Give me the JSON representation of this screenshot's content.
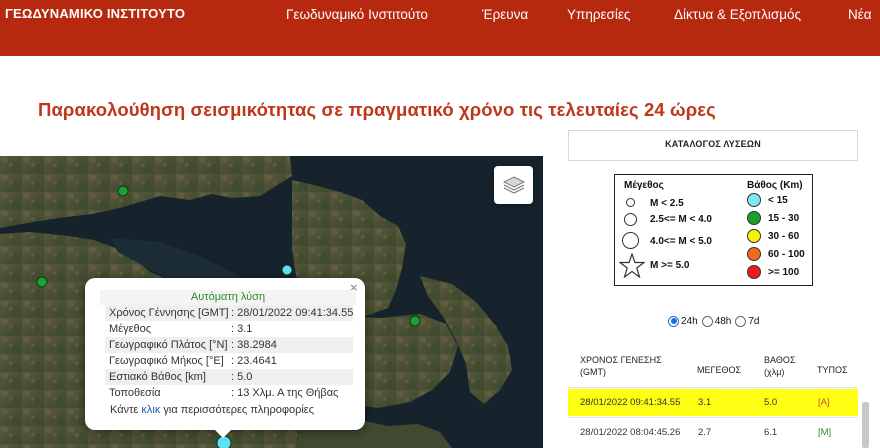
{
  "header": {
    "logo": "ΓΕΩΔΥΝΑΜΙΚΟ ΙΝΣΤΙΤΟΥΤΟ",
    "nav": [
      "Γεωδυναμικό Ινστιτούτο",
      "Έρευνα",
      "Υπηρεσίες",
      "Δίκτυα & Εξοπλισμός",
      "Νέα"
    ]
  },
  "page": {
    "title": "Παρακολούθηση σεισμικότητας σε πραγματικό χρόνο τις τελευταίες 24 ώρες"
  },
  "popup": {
    "heading": "Αυτόματη λύση",
    "close": "×",
    "rows": [
      {
        "label": "Χρόνος Γέννησης [GMT]",
        "value": ": 28/01/2022 09:41:34.55"
      },
      {
        "label": "Μέγεθος",
        "value": ": 3.1"
      },
      {
        "label": "Γεωγραφικό Πλάτος [°N]",
        "value": ": 38.2984"
      },
      {
        "label": "Γεωγραφικό Μήκος [°E]",
        "value": ": 23.4641"
      },
      {
        "label": "Εστιακό Βάθος [km]",
        "value": ": 5.0"
      },
      {
        "label": "Τοποθεσία",
        "value": ": 13 Χλμ. Α της Θήβας"
      }
    ],
    "more_prefix": "Κάντε",
    "more_link": "κλικ",
    "more_suffix": "για περισσότερες πληροφορίες"
  },
  "map": {
    "layers_icon": "layers-icon",
    "markers_color": "#1f9e3a",
    "selected_marker_color": "#5fe0f0"
  },
  "catalog": {
    "title": "ΚΑΤΑΛΟΓΟΣ ΛΥΣΕΩΝ",
    "legend": {
      "magnitude_title": "Μέγεθος",
      "magnitude_items": [
        "M < 2.5",
        "2.5<= M < 4.0",
        "4.0<= M < 5.0",
        "M >= 5.0"
      ],
      "depth_title": "Βάθος (Km)",
      "depth_items": [
        {
          "label": "< 15",
          "color": "#7fe7ee"
        },
        {
          "label": "15 - 30",
          "color": "#1e9f2a"
        },
        {
          "label": "30 - 60",
          "color": "#f4f20a"
        },
        {
          "label": "60 - 100",
          "color": "#f06a1e"
        },
        {
          "label": ">= 100",
          "color": "#ee1c1c"
        }
      ]
    },
    "periods": [
      "24h",
      "48h",
      "7d"
    ],
    "selected_period": "24h",
    "table": {
      "headers": {
        "time_1": "ΧΡΟΝΟΣ ΓΕΝΕΣΗΣ",
        "time_2": "(GMT)",
        "magnitude": "ΜΕΓΕΘΟΣ",
        "depth_1": "ΒΑΘΟΣ",
        "depth_2": "(χλμ)",
        "type": "ΤΥΠΟΣ"
      },
      "rows": [
        {
          "time": "28/01/2022 09:41:34.55",
          "magnitude": "3.1",
          "depth": "5.0",
          "type": "[A]",
          "type_color": "#d4472b",
          "highlighted": true
        },
        {
          "time": "28/01/2022 08:04:45.26",
          "magnitude": "2.7",
          "depth": "6.1",
          "type": "[M]",
          "type_color": "#2a8c2a",
          "highlighted": false
        }
      ]
    }
  }
}
